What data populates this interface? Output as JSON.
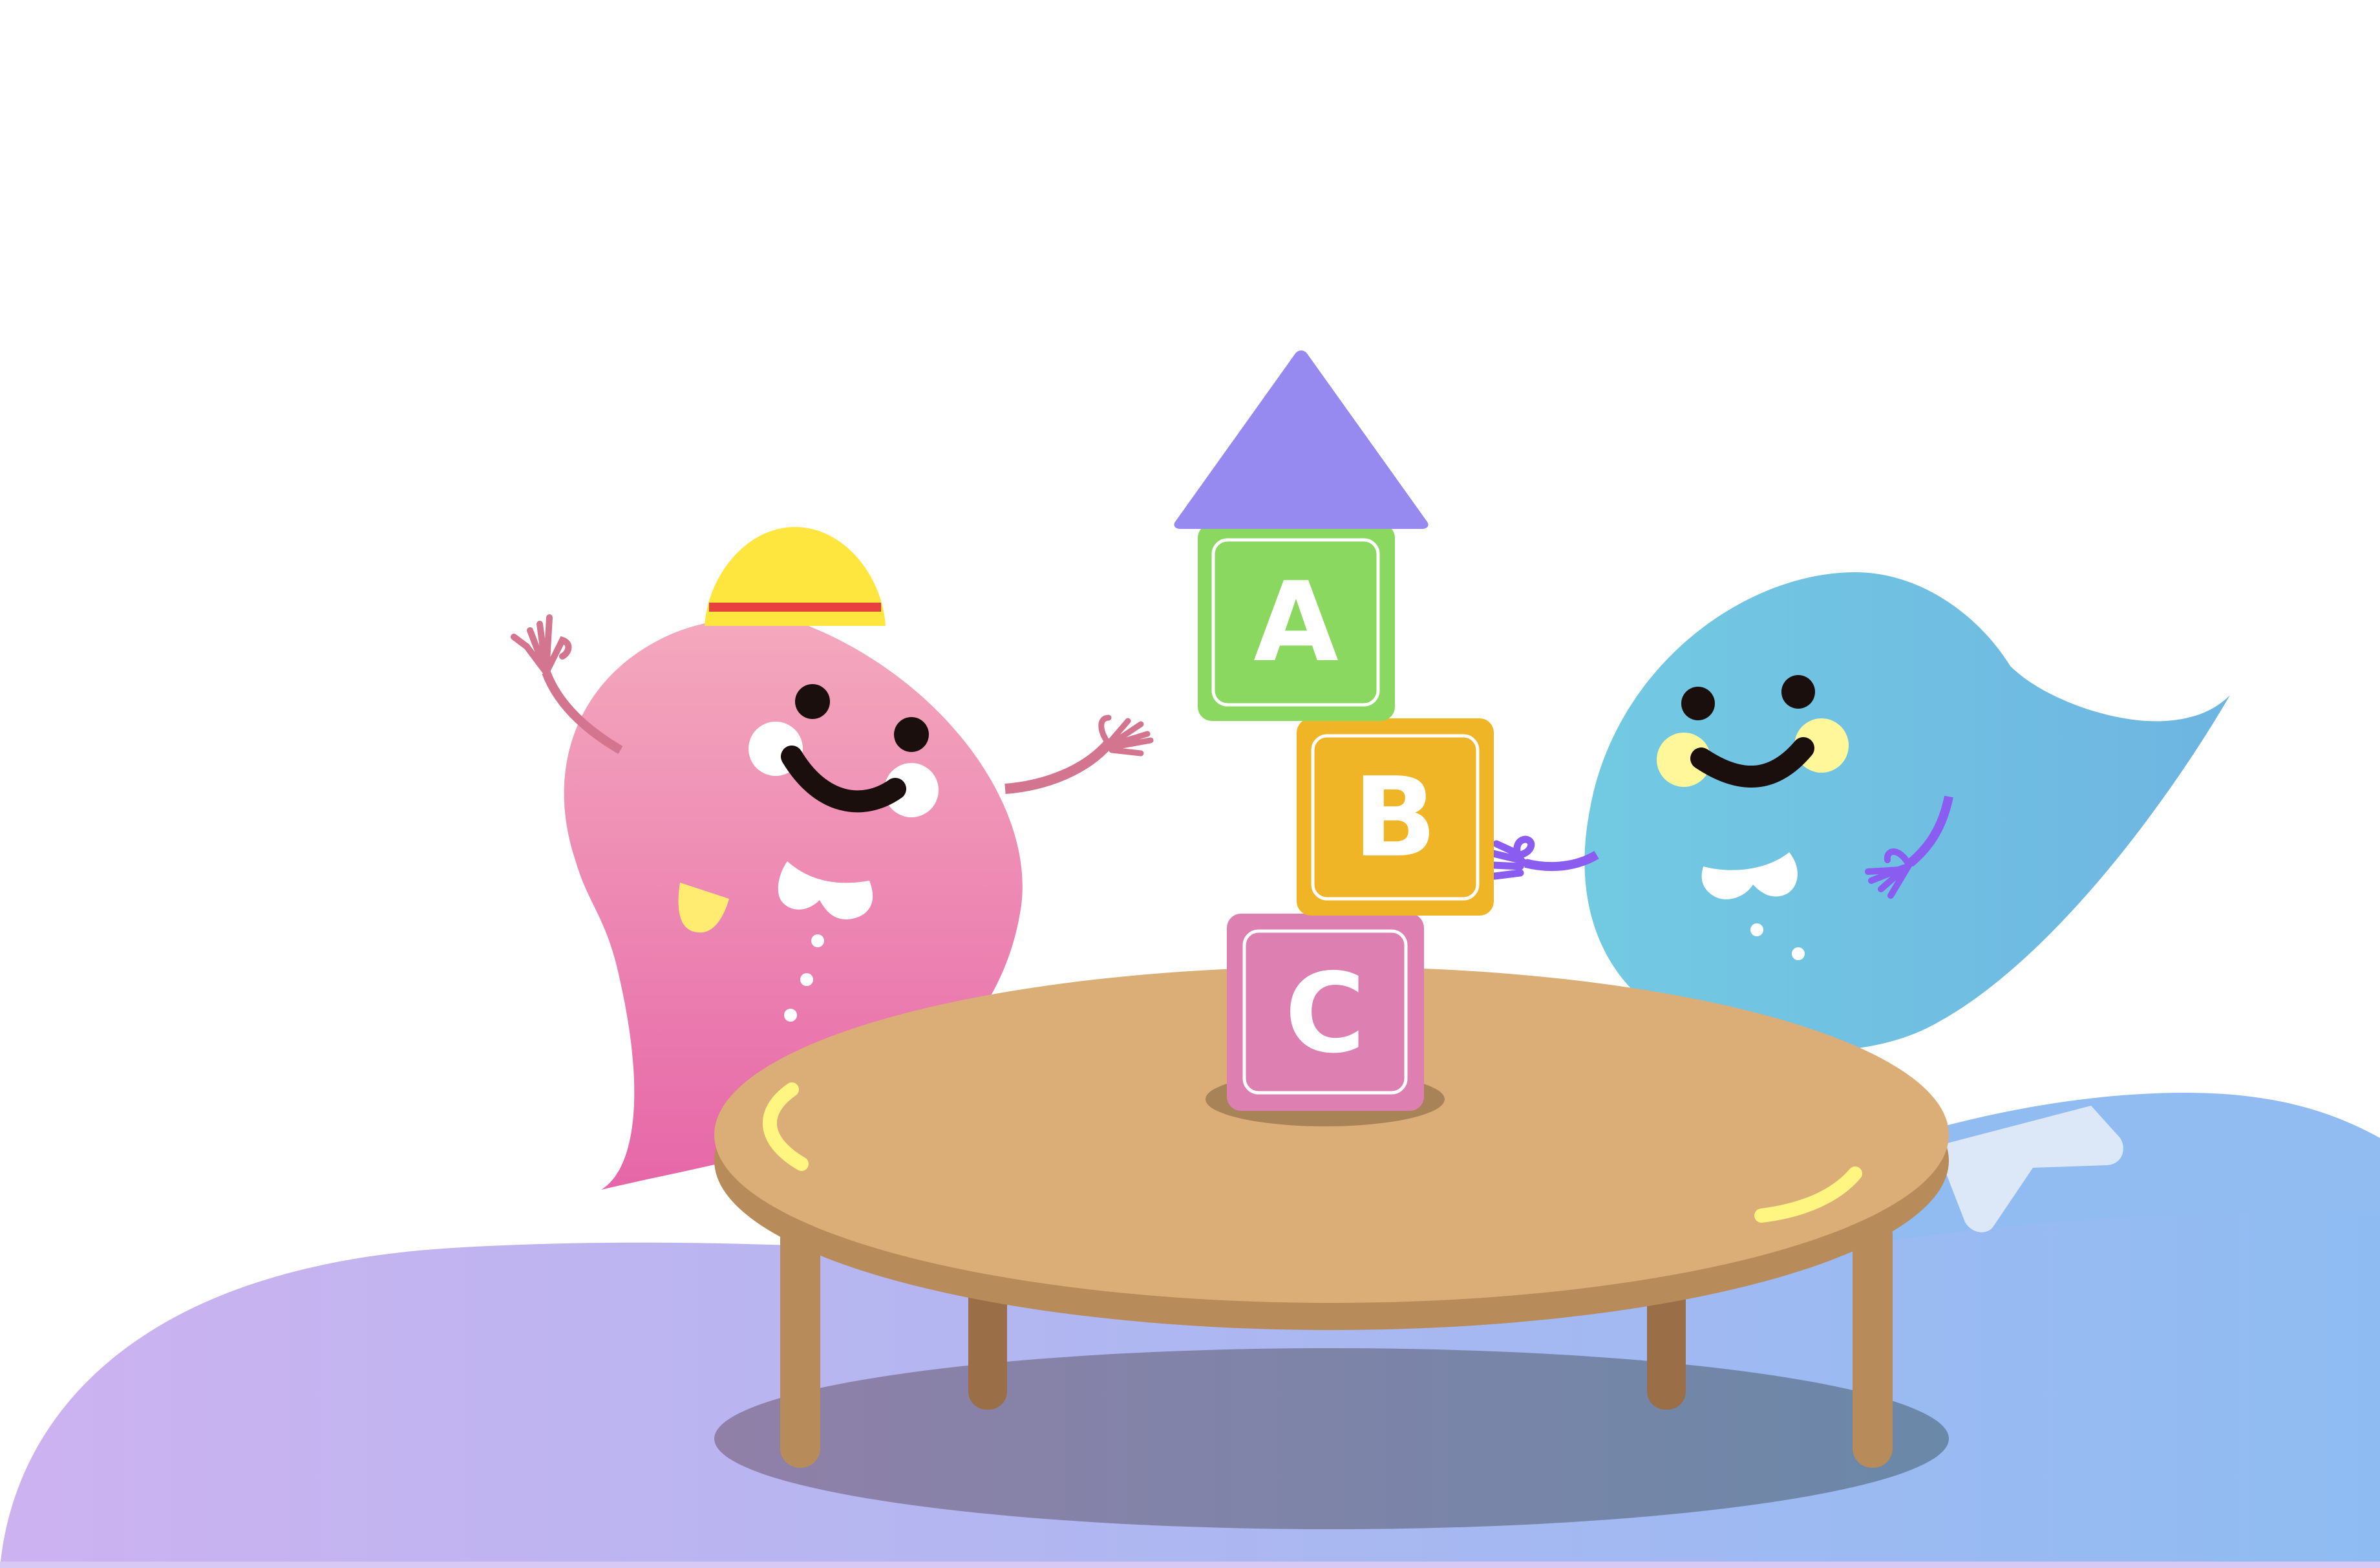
{
  "scene": {
    "description_free": true,
    "blocks": [
      {
        "letter": "A",
        "color": "#8ad860"
      },
      {
        "letter": "B",
        "color": "#f0b526"
      },
      {
        "letter": "C",
        "color": "#de7fb2"
      }
    ],
    "roof_color": "#968af0",
    "table_top_color": "#dcae77",
    "table_edge_color": "#b88b5a",
    "pink_character_color": "#f09ab5",
    "blue_character_color": "#70c4e2",
    "hat_color": "#ffe63f",
    "hat_band_color": "#e8403f",
    "hill_purple": "#ccb2f0",
    "hill_blue": "#90bcf2"
  }
}
